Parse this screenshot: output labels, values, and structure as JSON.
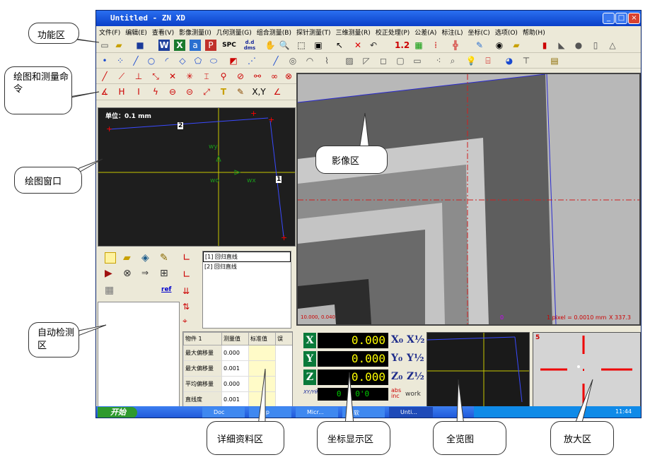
{
  "window": {
    "title": "Untitled - ZN XD"
  },
  "menu": [
    "文件(F)",
    "编辑(E)",
    "查看(V)",
    "影像测量(I)",
    "几何测量(G)",
    "组合测量(B)",
    "探针测量(T)",
    "三维测量(R)",
    "校正处理(P)",
    "公差(A)",
    "标注(L)",
    "坐标(C)",
    "选项(O)",
    "帮助(H)"
  ],
  "toolbar": {
    "spc": "SPC",
    "dims": "d.d dms",
    "num": "1.2",
    "xy": "X,Y"
  },
  "drawing": {
    "unit": "单位：0.1 mm",
    "marker1": "1",
    "marker2": "2",
    "wy": "wy",
    "wo": "wo",
    "wx": "wx"
  },
  "autodetect": {
    "list": [
      "[1] 回归直线",
      "[2] 回归直线"
    ],
    "ref": "ref"
  },
  "table": {
    "headers": [
      "物件 1",
      "测量值",
      "标准值",
      "误"
    ],
    "rows": [
      [
        "最大偏移量",
        "0.000"
      ],
      [
        "最大偏移量",
        "0.001"
      ],
      [
        "平均偏移量",
        "0.000"
      ],
      [
        "直线度",
        "0.001"
      ]
    ]
  },
  "coords": {
    "x": "0.000",
    "y": "0.000",
    "z": "0.000",
    "x0": "X₀",
    "x_half": "X½",
    "y0": "Y₀",
    "y_half": "Y½",
    "z0": "Z₀",
    "z_half": "Z½",
    "xy_label": "XY/Yθ",
    "angle": "0 - 0'0",
    "abs": "abs",
    "inc": "inc",
    "work": "work"
  },
  "image": {
    "pixel": "1 pixel = 0.0010 mm",
    "x": "X 337.3",
    "zero": "0",
    "left": "10.000, 0.040"
  },
  "zoom": {
    "label": "5"
  },
  "taskbar": {
    "start": "开始",
    "items": [
      "Doc",
      "...lp",
      "Micr...",
      "软",
      "Unti..."
    ],
    "clock": "11:44"
  },
  "callouts": {
    "func": "功能区",
    "drawcmd": "绘图和测量命令",
    "drawwin": "绘图窗口",
    "auto": "自动检测区",
    "image": "影像区",
    "detail": "详细资料区",
    "coord": "坐标显示区",
    "overview": "全览图",
    "zoomarea": "放大区"
  }
}
